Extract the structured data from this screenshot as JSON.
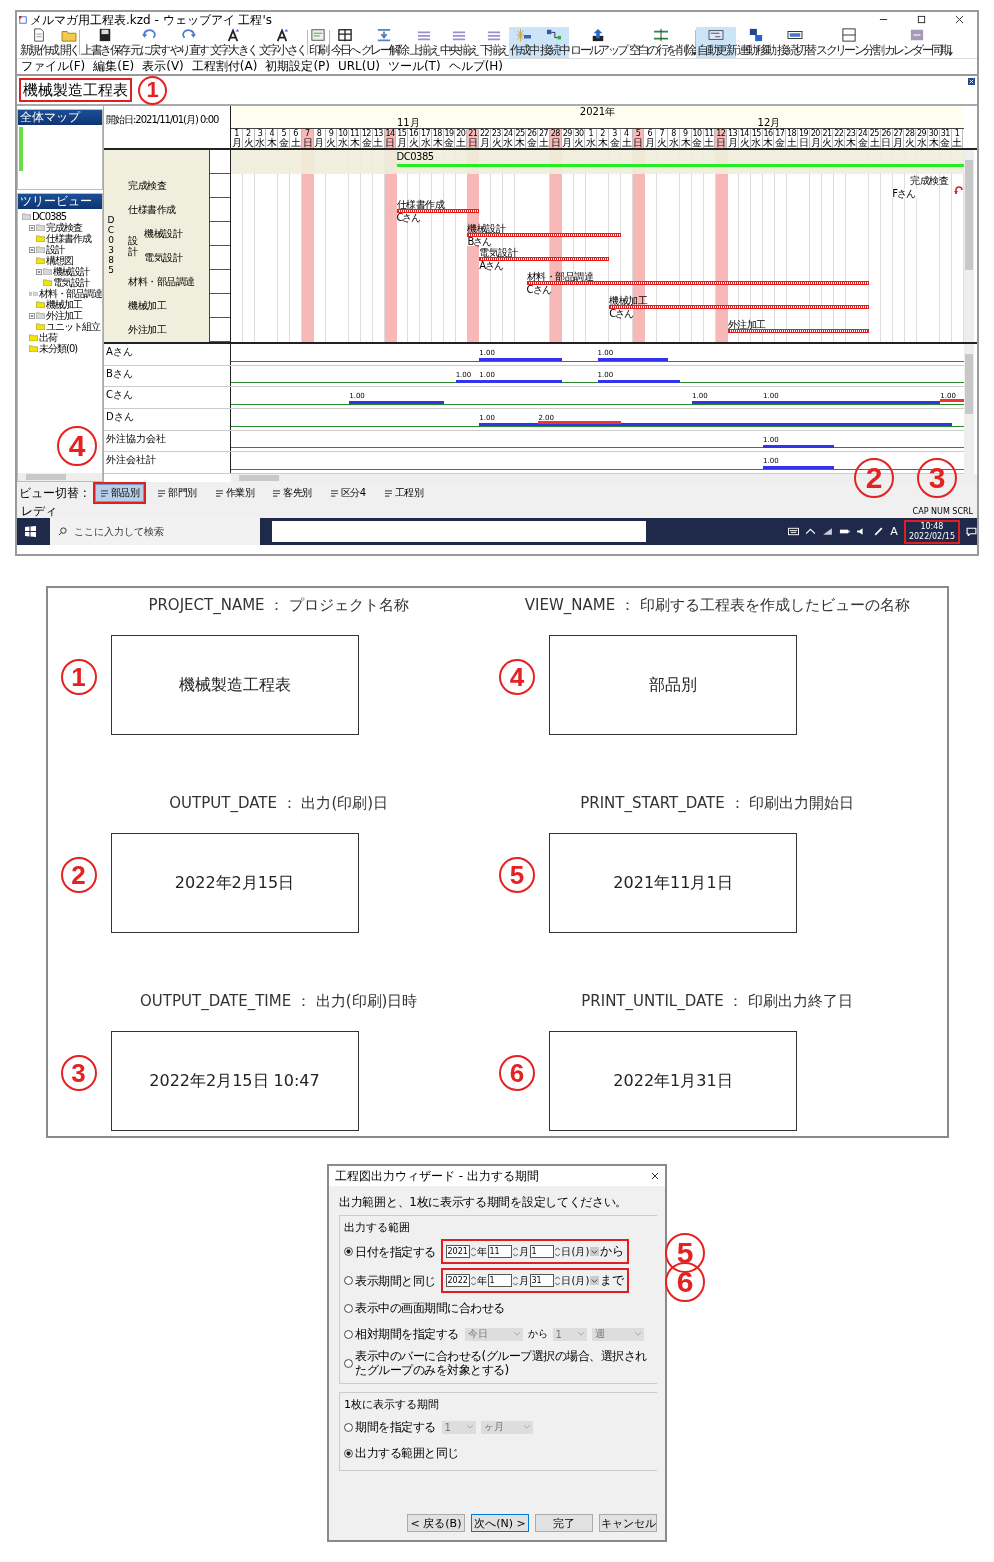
{
  "window": {
    "title": "メルマガ用工程表.kzd - ウェッブアイ 工程's"
  },
  "toolbar": [
    {
      "label": "新規作成",
      "selected": false,
      "dropdown": false
    },
    {
      "label": "開く",
      "selected": false,
      "dropdown": false
    },
    {
      "label": "上書き保存",
      "selected": false,
      "dropdown": false
    },
    {
      "label": "元に戻す",
      "selected": false,
      "dropdown": false
    },
    {
      "label": "やり直す",
      "selected": false,
      "dropdown": false
    },
    {
      "label": "文字大きく",
      "selected": false,
      "dropdown": false
    },
    {
      "label": "文字小さく",
      "selected": false,
      "dropdown": false
    },
    {
      "label": "印刷",
      "selected": false,
      "dropdown": false
    },
    {
      "label": "今日へ",
      "selected": false,
      "dropdown": false
    },
    {
      "label": "グレー解除",
      "selected": false,
      "dropdown": false
    },
    {
      "label": "上揃え",
      "selected": false,
      "dropdown": false
    },
    {
      "label": "中央揃え",
      "selected": false,
      "dropdown": false
    },
    {
      "label": "下揃え",
      "selected": false,
      "dropdown": false
    },
    {
      "label": "作成中",
      "selected": true,
      "dropdown": false
    },
    {
      "label": "接続中",
      "selected": true,
      "dropdown": false
    },
    {
      "label": "ロールアップ",
      "selected": false,
      "dropdown": false
    },
    {
      "label": "空白の行を削除",
      "selected": false,
      "dropdown": true
    },
    {
      "label": "自動更新",
      "selected": true,
      "dropdown": false
    },
    {
      "label": "連動移動",
      "selected": false,
      "dropdown": false
    },
    {
      "label": "接続切替",
      "selected": false,
      "dropdown": false
    },
    {
      "label": "スクリーン分割",
      "selected": false,
      "dropdown": false
    },
    {
      "label": "カレンダー同期",
      "selected": false,
      "dropdown": true
    }
  ],
  "menu": [
    "ファイル(F)",
    "編集(E)",
    "表示(V)",
    "工程割付(A)",
    "初期設定(P)",
    "URL(U)",
    "ツール(T)",
    "ヘルプ(H)"
  ],
  "project_title": {
    "text": "機械製造工程表",
    "marker": "1"
  },
  "map_panel": {
    "title": "全体マップ"
  },
  "tree_panel": {
    "title": "ツリービュー",
    "items": [
      {
        "label": "DC0385",
        "children": [
          {
            "label": "完成検査",
            "children": [
              {
                "label": "仕様書作成"
              }
            ]
          },
          {
            "label": "設計",
            "children": [
              {
                "label": "構想図"
              },
              {
                "label": "機械設計",
                "children": [
                  {
                    "label": "電気設計"
                  }
                ]
              }
            ]
          },
          {
            "label": "材料・部品調達",
            "children": [
              {
                "label": "機械加工"
              }
            ]
          },
          {
            "label": "外注加工",
            "children": [
              {
                "label": "ユニット組立"
              }
            ]
          },
          {
            "label": "出荷"
          },
          {
            "label": "未分類(0)"
          }
        ]
      }
    ]
  },
  "gantt": {
    "start_label": "開始日:2021/11/01(月) 0:00",
    "year": "2021年",
    "months": [
      {
        "label": "11月"
      },
      {
        "label": "12月"
      }
    ],
    "days": [
      {
        "d": "1",
        "w": "月",
        "holiday": false
      },
      {
        "d": "2",
        "w": "火",
        "holiday": false
      },
      {
        "d": "3",
        "w": "水",
        "holiday": false
      },
      {
        "d": "4",
        "w": "木",
        "holiday": false
      },
      {
        "d": "5",
        "w": "金",
        "holiday": false
      },
      {
        "d": "6",
        "w": "土",
        "holiday": false
      },
      {
        "d": "7",
        "w": "日",
        "holiday": true
      },
      {
        "d": "8",
        "w": "月",
        "holiday": false
      },
      {
        "d": "9",
        "w": "火",
        "holiday": false
      },
      {
        "d": "10",
        "w": "水",
        "holiday": false
      },
      {
        "d": "11",
        "w": "木",
        "holiday": false
      },
      {
        "d": "12",
        "w": "金",
        "holiday": false
      },
      {
        "d": "13",
        "w": "土",
        "holiday": false
      },
      {
        "d": "14",
        "w": "日",
        "holiday": true
      },
      {
        "d": "15",
        "w": "月",
        "holiday": false
      },
      {
        "d": "16",
        "w": "火",
        "holiday": false
      },
      {
        "d": "17",
        "w": "水",
        "holiday": false
      },
      {
        "d": "18",
        "w": "木",
        "holiday": false
      },
      {
        "d": "19",
        "w": "金",
        "holiday": false
      },
      {
        "d": "20",
        "w": "土",
        "holiday": false
      },
      {
        "d": "21",
        "w": "日",
        "holiday": true
      },
      {
        "d": "22",
        "w": "月",
        "holiday": false
      },
      {
        "d": "23",
        "w": "火",
        "holiday": false
      },
      {
        "d": "24",
        "w": "水",
        "holiday": false
      },
      {
        "d": "25",
        "w": "木",
        "holiday": false
      },
      {
        "d": "26",
        "w": "金",
        "holiday": false
      },
      {
        "d": "27",
        "w": "土",
        "holiday": false
      },
      {
        "d": "28",
        "w": "日",
        "holiday": true
      },
      {
        "d": "29",
        "w": "月",
        "holiday": false
      },
      {
        "d": "30",
        "w": "火",
        "holiday": false
      },
      {
        "d": "1",
        "w": "水",
        "holiday": false
      },
      {
        "d": "2",
        "w": "木",
        "holiday": false
      },
      {
        "d": "3",
        "w": "金",
        "holiday": false
      },
      {
        "d": "4",
        "w": "土",
        "holiday": false
      },
      {
        "d": "5",
        "w": "日",
        "holiday": true
      },
      {
        "d": "6",
        "w": "月",
        "holiday": false
      },
      {
        "d": "7",
        "w": "火",
        "holiday": false
      },
      {
        "d": "8",
        "w": "水",
        "holiday": false
      },
      {
        "d": "9",
        "w": "木",
        "holiday": false
      },
      {
        "d": "10",
        "w": "金",
        "holiday": false
      },
      {
        "d": "11",
        "w": "土",
        "holiday": false
      },
      {
        "d": "12",
        "w": "日",
        "holiday": true
      },
      {
        "d": "13",
        "w": "月",
        "holiday": false
      },
      {
        "d": "14",
        "w": "火",
        "holiday": false
      },
      {
        "d": "15",
        "w": "水",
        "holiday": false
      },
      {
        "d": "16",
        "w": "木",
        "holiday": false
      },
      {
        "d": "17",
        "w": "金",
        "holiday": false
      },
      {
        "d": "18",
        "w": "土",
        "holiday": false
      },
      {
        "d": "19",
        "w": "日",
        "holiday": false
      },
      {
        "d": "20",
        "w": "月",
        "holiday": false
      },
      {
        "d": "21",
        "w": "火",
        "holiday": false
      },
      {
        "d": "22",
        "w": "水",
        "holiday": false
      },
      {
        "d": "23",
        "w": "木",
        "holiday": false
      },
      {
        "d": "24",
        "w": "金",
        "holiday": false
      },
      {
        "d": "25",
        "w": "土",
        "holiday": false
      },
      {
        "d": "26",
        "w": "日",
        "holiday": false
      },
      {
        "d": "27",
        "w": "月",
        "holiday": false
      },
      {
        "d": "28",
        "w": "火",
        "holiday": false
      },
      {
        "d": "29",
        "w": "水",
        "holiday": false
      },
      {
        "d": "30",
        "w": "木",
        "holiday": false
      },
      {
        "d": "31",
        "w": "金",
        "holiday": false
      },
      {
        "d": "1",
        "w": "土",
        "holiday": false
      }
    ],
    "group_label": "DC0385",
    "summary": {
      "label": "DC0385"
    },
    "tasks": [
      {
        "kind": "task",
        "name": "完成検査",
        "bar": {
          "kind": "milestone",
          "label": "完成検査",
          "assignee": "Fさん"
        }
      },
      {
        "kind": "task",
        "name": "仕様書作成",
        "bar": {
          "kind": "bar",
          "label": "仕様書作成",
          "assignee": "Cさん"
        }
      },
      {
        "kind": "group",
        "name": "設計",
        "children": [
          {
            "kind": "task",
            "name": "機械設計",
            "bar": {
              "kind": "bar",
              "label": "機械設計",
              "assignee": "Bさん"
            }
          },
          {
            "kind": "task",
            "name": "電気設計",
            "bar": {
              "kind": "bar",
              "label": "電気設計",
              "assignee": "Aさん"
            }
          }
        ]
      },
      {
        "kind": "task",
        "name": "材料・部品調達",
        "bar": {
          "kind": "bar",
          "label": "材料・部品調達",
          "assignee": "Cさん"
        }
      },
      {
        "kind": "task",
        "name": "機械加工",
        "bar": {
          "kind": "bar",
          "label": "機械加工",
          "assignee": "Cさん"
        }
      },
      {
        "kind": "task",
        "name": "外注加工",
        "bar": {
          "kind": "bar",
          "label": "外注加工"
        }
      }
    ],
    "resources": [
      {
        "name": "Aさん",
        "loads": [
          {
            "value": "1.00",
            "over": false
          },
          {
            "value": "1.00",
            "over": false
          }
        ]
      },
      {
        "name": "Bさん",
        "loads": [
          {
            "value": "1.00",
            "over": false
          },
          {
            "value": "1.00",
            "over": false
          },
          {
            "value": "1.00",
            "over": false
          }
        ]
      },
      {
        "name": "Cさん",
        "loads": [
          {
            "value": "1.00",
            "over": false
          },
          {
            "value": "1.00",
            "over": false
          },
          {
            "value": "1.00",
            "over": false
          },
          {
            "value": "1.00",
            "over": true
          }
        ]
      },
      {
        "name": "Dさん",
        "loads": [
          {
            "value": "1.00",
            "over": false
          },
          {
            "value": "2.00",
            "over": true
          }
        ]
      },
      {
        "name": "外注協力会社",
        "loads": [
          {
            "value": "1.00",
            "over": false
          }
        ]
      },
      {
        "name": "外注会社計",
        "loads": [
          {
            "value": "1.00",
            "over": false
          }
        ]
      }
    ]
  },
  "view_tabs": {
    "label": "ビュー切替 :",
    "tabs": [
      {
        "label": "部品別",
        "selected": true,
        "marker": "4"
      },
      {
        "label": "部門別",
        "selected": false
      },
      {
        "label": "作業別",
        "selected": false
      },
      {
        "label": "客先別",
        "selected": false
      },
      {
        "label": "区分4",
        "selected": false
      },
      {
        "label": "工程別",
        "selected": false
      }
    ]
  },
  "status_bar": {
    "text": "レディ",
    "indicators": "CAP NUM SCRL"
  },
  "taskbar": {
    "search_placeholder": "ここに入力して検索",
    "ime": "A",
    "time": "10:48",
    "date": "2022/02/15",
    "markers": [
      "2",
      "3"
    ]
  },
  "fields": [
    {
      "marker": "1",
      "heading": "PROJECT_NAME ： プロジェクト名称",
      "value": "機械製造工程表"
    },
    {
      "marker": "4",
      "heading": "VIEW_NAME ： 印刷する工程表を作成したビューの名称",
      "value": "部品別"
    },
    {
      "marker": "2",
      "heading": "OUTPUT_DATE ： 出力(印刷)日",
      "value": "2022年2月15日"
    },
    {
      "marker": "5",
      "heading": "PRINT_START_DATE ： 印刷出力開始日",
      "value": "2021年11月1日"
    },
    {
      "marker": "3",
      "heading": "OUTPUT_DATE_TIME ： 出力(印刷)日時",
      "value": "2022年2月15日 10:47"
    },
    {
      "marker": "6",
      "heading": "PRINT_UNTIL_DATE ： 印刷出力終了日",
      "value": "2022年1月31日"
    }
  ],
  "dialog": {
    "title": "工程図出力ウィザード - 出力する期間",
    "instruction": "出力範囲と、1枚に表示する期間を設定してください。",
    "range": {
      "title": "出力する範囲",
      "options": [
        {
          "kind": "date",
          "label": "日付を指定する",
          "selected": true,
          "year": "2021",
          "year_unit": "年",
          "month": "11",
          "month_unit": "月",
          "day": "1",
          "day_unit": "日",
          "weekday": "(月)",
          "suffix": "から",
          "marker": "5"
        },
        {
          "kind": "date",
          "label": "表示期間と同じ",
          "selected": false,
          "year": "2022",
          "year_unit": "年",
          "month": "1",
          "month_unit": "月",
          "day": "31",
          "day_unit": "日",
          "weekday": "(月)",
          "suffix": "まで",
          "marker": "6"
        },
        {
          "kind": "plain",
          "label": "表示中の画面期間に合わせる",
          "selected": false
        },
        {
          "kind": "relative",
          "label": "相対期間を指定する",
          "selected": false,
          "base": "今日",
          "from": "から",
          "count": "1",
          "unit": "週"
        },
        {
          "kind": "plain",
          "label": "表示中のバーに合わせる(グループ選択の場合、選択されたグループのみを対象とする)",
          "selected": false
        }
      ]
    },
    "page": {
      "title": "1枚に表示する期間",
      "options": [
        {
          "kind": "period",
          "label": "期間を指定する",
          "selected": false,
          "count": "1",
          "unit": "ヶ月"
        },
        {
          "kind": "plain",
          "label": "出力する範囲と同じ",
          "selected": true
        }
      ]
    },
    "buttons": [
      {
        "label": "< 戻る(B)",
        "primary": false
      },
      {
        "label": "次へ(N) >",
        "primary": true
      },
      {
        "label": "完了",
        "primary": false
      },
      {
        "label": "キャンセル",
        "primary": false
      }
    ]
  }
}
